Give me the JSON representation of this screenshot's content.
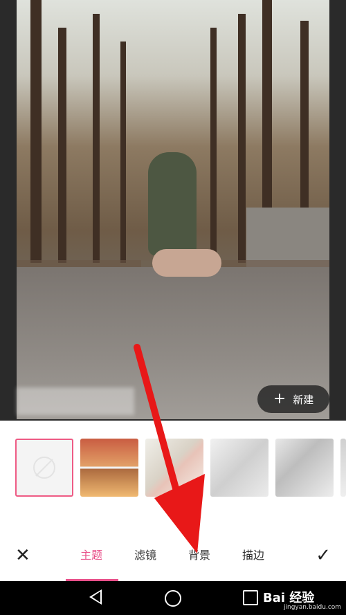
{
  "photo": {
    "new_button_label": "新建"
  },
  "thumbnails": [
    {
      "name": "none"
    },
    {
      "name": "comic-theme-1"
    },
    {
      "name": "comic-theme-2"
    },
    {
      "name": "comic-theme-3"
    },
    {
      "name": "comic-theme-4"
    },
    {
      "name": "comic-theme-5"
    }
  ],
  "tabs": [
    {
      "label": "主题",
      "active": true
    },
    {
      "label": "滤镜",
      "active": false
    },
    {
      "label": "背景",
      "active": false
    },
    {
      "label": "描边",
      "active": false
    }
  ],
  "toolbar": {
    "close_icon": "close-icon",
    "confirm_icon": "check-icon"
  },
  "watermark": {
    "brand": "Bai 经验",
    "url": "jingyan.baidu.com"
  },
  "colors": {
    "accent": "#e8508a",
    "arrow": "#e81818"
  }
}
